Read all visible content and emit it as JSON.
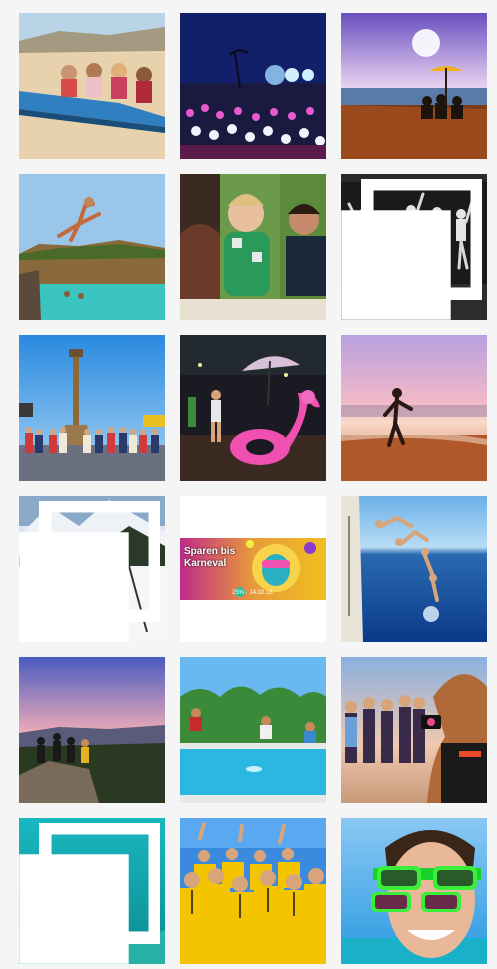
{
  "feed": {
    "tiles": [
      {
        "id": "beach-surf-kids"
      },
      {
        "id": "beach-festival-night"
      },
      {
        "id": "sunset-umbrella"
      },
      {
        "id": "cliff-jump"
      },
      {
        "id": "laughing-teens"
      },
      {
        "id": "dance-group-jump",
        "multiple": true
      },
      {
        "id": "columbus-monument-group"
      },
      {
        "id": "flamingo-party"
      },
      {
        "id": "beach-silhouette"
      },
      {
        "id": "ski-trip",
        "multiple": true
      },
      {
        "id": "karneval-promo",
        "line1": "Sparen bis",
        "line2": "Karneval",
        "small": "25% · 14.02.18"
      },
      {
        "id": "boat-jump"
      },
      {
        "id": "mountain-sunset-hikers"
      },
      {
        "id": "pool-jump"
      },
      {
        "id": "beach-selfie-phone"
      },
      {
        "id": "underwater-snorkel",
        "multiple": true
      },
      {
        "id": "yellow-team-cheer"
      },
      {
        "id": "green-sunglasses"
      }
    ]
  },
  "colors": {
    "page_bg": "#f5f5f5",
    "team_yellow": "#f4c400",
    "promo_pink": "#e0308a"
  }
}
